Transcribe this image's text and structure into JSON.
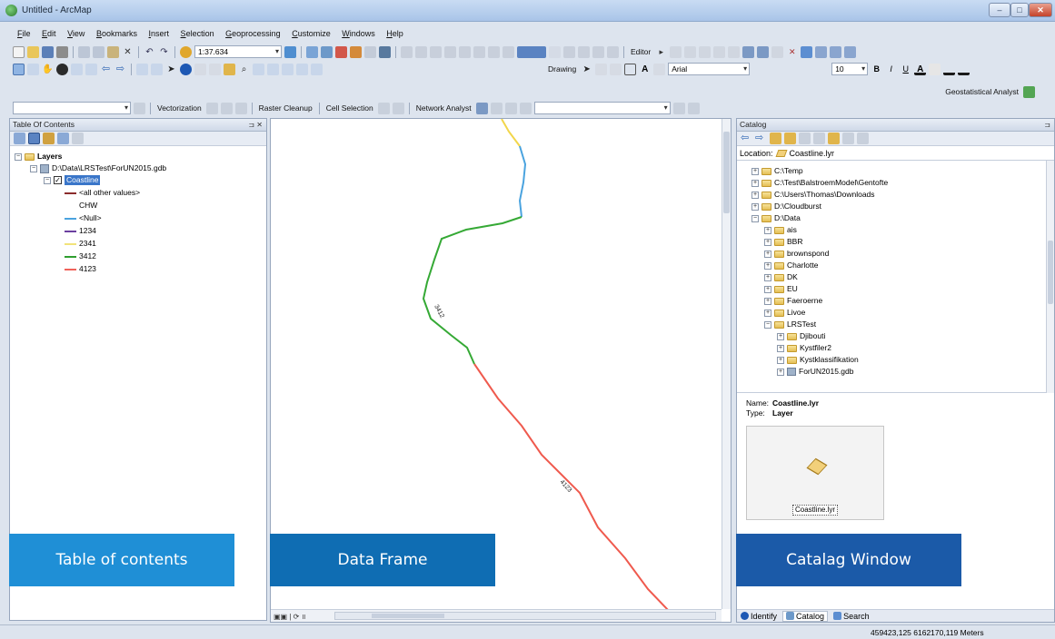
{
  "window": {
    "title": "Untitled - ArcMap"
  },
  "menu": [
    "File",
    "Edit",
    "View",
    "Bookmarks",
    "Insert",
    "Selection",
    "Geoprocessing",
    "Customize",
    "Windows",
    "Help"
  ],
  "toolbar": {
    "scale": "1:37.634",
    "drawing_label": "Drawing",
    "font_name": "Arial",
    "font_size": "10",
    "editor_label": "Editor",
    "geostatistical_label": "Geostatistical Analyst",
    "vectorization_label": "Vectorization",
    "raster_cleanup_label": "Raster Cleanup",
    "cell_selection_label": "Cell Selection",
    "network_analyst_label": "Network Analyst"
  },
  "toc": {
    "header": "Table Of Contents",
    "layers_label": "Layers",
    "gdb_path": "D:\\Data\\LRSTest\\ForUN2015.gdb",
    "layer_name": "Coastline",
    "legend": [
      {
        "label": "<all other values>",
        "color": "#8b2c2c"
      },
      {
        "label": "CHW",
        "color": ""
      },
      {
        "label": "<Null>",
        "color": "#4aa3df"
      },
      {
        "label": "1234",
        "color": "#6b3fa0"
      },
      {
        "label": "2341",
        "color": "#f2e37a"
      },
      {
        "label": "3412",
        "color": "#2f9e2f"
      },
      {
        "label": "4123",
        "color": "#f0625a"
      }
    ]
  },
  "map": {
    "label_3412": "3412",
    "label_4123": "4123",
    "colors": {
      "yellow": "#f2d64b",
      "blue": "#4aa3df",
      "green": "#35a935",
      "red": "#ef5a4e"
    }
  },
  "catalog": {
    "header": "Catalog",
    "location_label": "Location:",
    "location_value": "Coastline.lyr",
    "tree": [
      {
        "label": "C:\\Temp",
        "level": 0
      },
      {
        "label": "C:\\Test\\BalstroemModel\\Gentofte",
        "level": 0
      },
      {
        "label": "C:\\Users\\Thomas\\Downloads",
        "level": 0
      },
      {
        "label": "D:\\Cloudburst",
        "level": 0
      },
      {
        "label": "D:\\Data",
        "level": 0
      },
      {
        "label": "ais",
        "level": 1
      },
      {
        "label": "BBR",
        "level": 1
      },
      {
        "label": "brownspond",
        "level": 1
      },
      {
        "label": "Charlotte",
        "level": 1
      },
      {
        "label": "DK",
        "level": 1
      },
      {
        "label": "EU",
        "level": 1
      },
      {
        "label": "Faeroerne",
        "level": 1
      },
      {
        "label": "Livoe",
        "level": 1
      },
      {
        "label": "LRSTest",
        "level": 1
      },
      {
        "label": "Djibouti",
        "level": 2
      },
      {
        "label": "Kystfiler2",
        "level": 2
      },
      {
        "label": "Kystklassifikation",
        "level": 2
      },
      {
        "label": "ForUN2015.gdb",
        "level": 2
      }
    ],
    "name_label": "Name:",
    "name_value": "Coastline.lyr",
    "type_label": "Type:",
    "type_value": "Layer",
    "preview_caption": "Coastline.lyr",
    "tabs": [
      "Identify",
      "Catalog",
      "Search"
    ]
  },
  "callouts": {
    "toc": "Table of contents",
    "data_frame": "Data Frame",
    "catalog": "Catalag Window"
  },
  "status": {
    "coordinates": "459423,125  6162170,119 Meters"
  }
}
